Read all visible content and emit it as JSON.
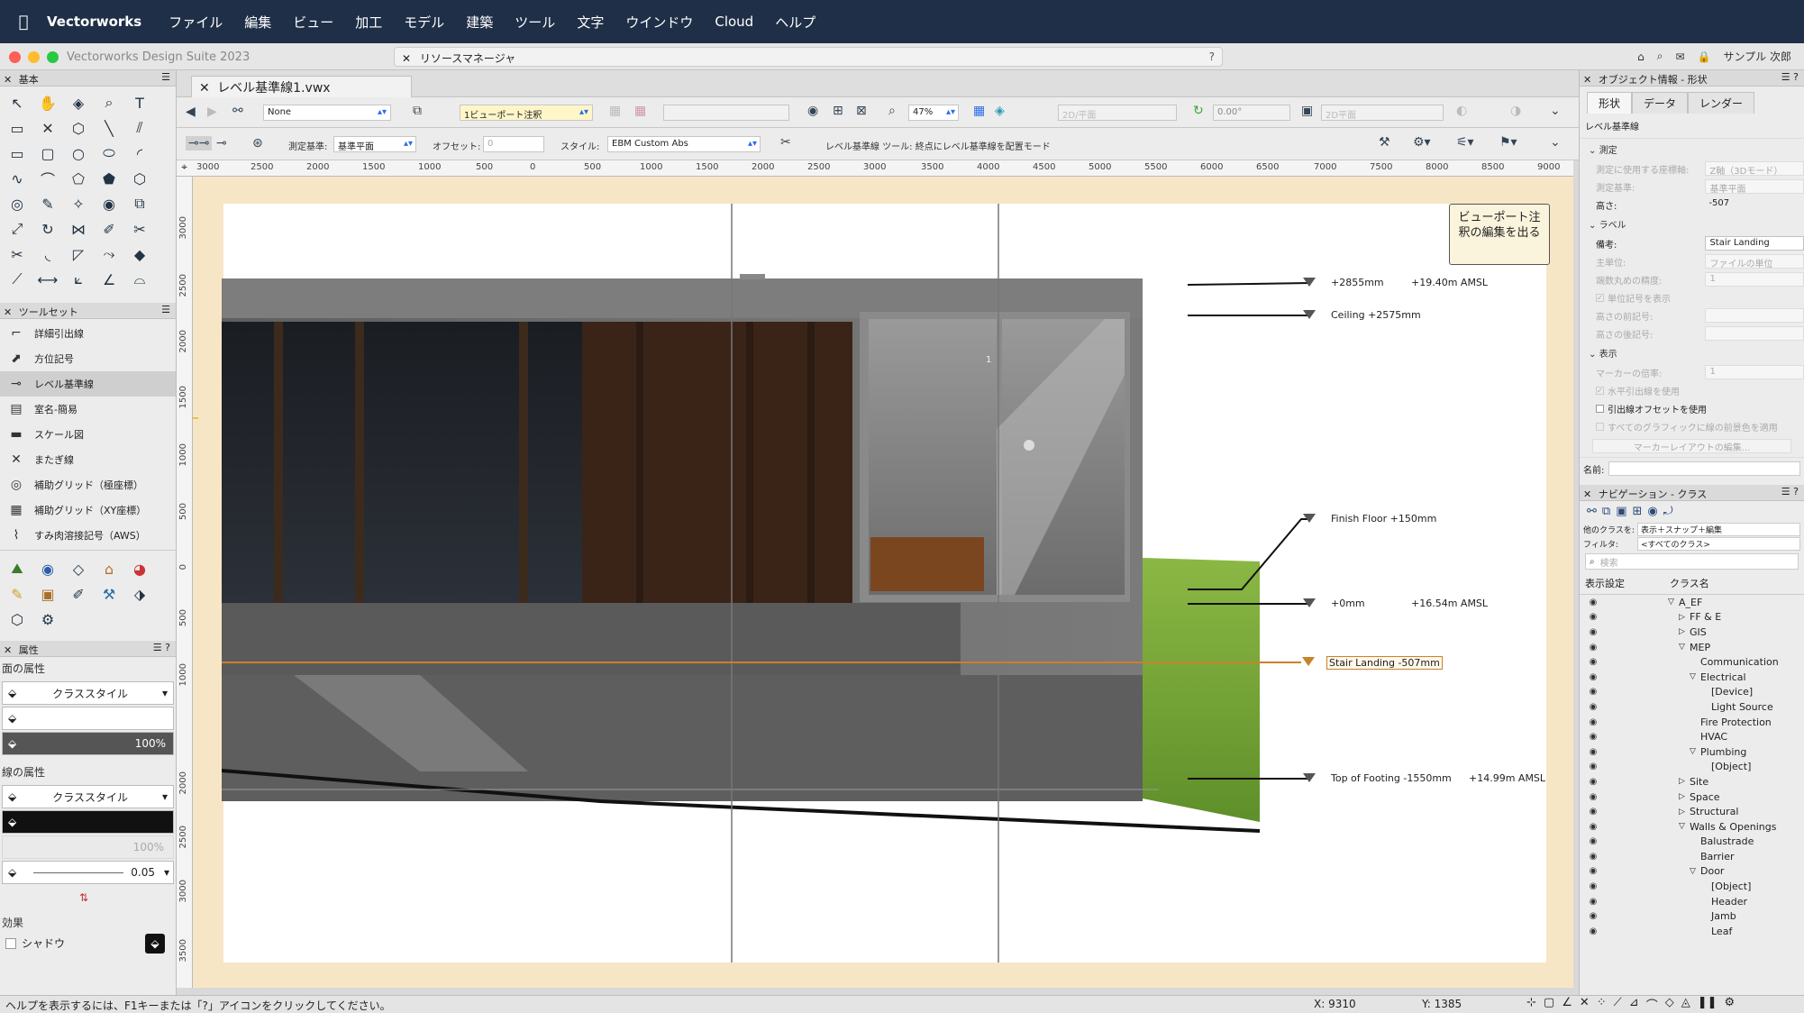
{
  "menubar": {
    "app_name": "Vectorworks",
    "items": [
      "ファイル",
      "編集",
      "ビュー",
      "加工",
      "モデル",
      "建築",
      "ツール",
      "文字",
      "ウインドウ",
      "Cloud",
      "ヘルプ"
    ]
  },
  "window": {
    "app_title": "Vectorworks Design Suite 2023",
    "resource_manager": "リソースマネージャ",
    "resource_manager_help": "?",
    "user": "サンプル 次郎"
  },
  "left_panel": {
    "basic_title": "基本",
    "toolset_title": "ツールセット",
    "toolset_items": [
      {
        "label": "詳細引出線",
        "icon": "detail-callout-icon"
      },
      {
        "label": "方位記号",
        "icon": "north-arrow-icon"
      },
      {
        "label": "レベル基準線",
        "icon": "level-datum-icon",
        "selected": true
      },
      {
        "label": "室名-簡易",
        "icon": "room-name-icon"
      },
      {
        "label": "スケール図",
        "icon": "scale-bar-icon"
      },
      {
        "label": "またぎ線",
        "icon": "cross-line-icon"
      },
      {
        "label": "補助グリッド（極座標）",
        "icon": "polar-grid-icon"
      },
      {
        "label": "補助グリッド（XY座標）",
        "icon": "xy-grid-icon"
      },
      {
        "label": "すみ肉溶接記号（AWS）",
        "icon": "weld-symbol-icon"
      }
    ],
    "attributes_title": "属性",
    "fill_label": "面の属性",
    "fill_style": "クラススタイル",
    "opacity": "100%",
    "pen_label": "線の属性",
    "pen_style": "クラススタイル",
    "pen_opacity": "100%",
    "line_weight": "0.05",
    "effects_label": "効果",
    "shadow_label": "シャドウ"
  },
  "document": {
    "tab_title": "レベル基準線1.vwx",
    "view": {
      "class_value": "None",
      "layer_value": "1ビューポート注釈",
      "zoom": "47%",
      "view_type": "2D/平面",
      "rotation": "0.00°",
      "plane": "2D平面"
    },
    "mode": {
      "measure_label": "測定基準:",
      "measure_value": "基準平面",
      "offset_label": "オフセット:",
      "offset_value": "0",
      "style_label": "スタイル:",
      "style_value": "EBM Custom Abs",
      "hint": "レベル基準線 ツール: 終点にレベル基準線を配置モード"
    }
  },
  "ruler": {
    "top": [
      "3000",
      "2500",
      "2000",
      "1500",
      "1000",
      "500",
      "0",
      "500",
      "1000",
      "1500",
      "2000",
      "2500",
      "3000",
      "3500",
      "4000",
      "4500",
      "5000",
      "5500",
      "6000",
      "6500",
      "7000",
      "7500",
      "8000",
      "8500",
      "9000"
    ],
    "left": [
      "3000",
      "2500",
      "2000",
      "1500",
      "1000",
      "500",
      "0",
      "500",
      "1000",
      "2000",
      "2500",
      "3000",
      "3500"
    ]
  },
  "drawing": {
    "exit_button": "ビューポート注釈の編集を出る",
    "levels": [
      {
        "label": "+2855mm",
        "amsl": "+19.40m AMSL"
      },
      {
        "label": "Ceiling +2575mm",
        "amsl": ""
      },
      {
        "label": "Finish Floor +150mm",
        "amsl": ""
      },
      {
        "label": "+0mm",
        "amsl": "+16.54m AMSL"
      },
      {
        "label": "Stair Landing -507mm",
        "amsl": ""
      },
      {
        "label": "Top of Footing -1550mm",
        "amsl": "+14.99m AMSL"
      }
    ],
    "shower_tag": "1"
  },
  "object_info": {
    "title": "オブジェクト情報 - 形状",
    "tabs": [
      "形状",
      "データ",
      "レンダー"
    ],
    "object_type": "レベル基準線",
    "section_measure": "測定",
    "rows_measure": [
      {
        "label": "測定に使用する座標軸:",
        "value": "Z軸（3Dモード）"
      },
      {
        "label": "測定基準:",
        "value": "基準平面"
      },
      {
        "label": "高さ:",
        "value": "-507",
        "enabled": true
      }
    ],
    "section_label": "ラベル",
    "rows_label": [
      {
        "label": "備考:",
        "value": "Stair Landing",
        "enabled": true
      },
      {
        "label": "主単位:",
        "value": "ファイルの単位"
      },
      {
        "label": "端数丸めの精度:",
        "value": "1"
      }
    ],
    "check_unit": "単位記号を表示",
    "rows_label2": [
      {
        "label": "高さの前記号:",
        "value": ""
      },
      {
        "label": "高さの後記号:",
        "value": ""
      }
    ],
    "section_display": "表示",
    "rows_display": [
      {
        "label": "マーカーの倍率:",
        "value": "1"
      }
    ],
    "check_horizontal": "水平引出線を使用",
    "check_offset": "引出線オフセットを使用",
    "check_all_graphic": "すべてのグラフィックに線の前景色を適用",
    "marker_button": "マーカーレイアウトの編集...",
    "name_label": "名前:",
    "name_value": ""
  },
  "navigation": {
    "title": "ナビゲーション - クラス",
    "other_classes_label": "他のクラスを:",
    "other_classes_value": "表示＋スナップ＋編集",
    "filter_label": "フィルタ:",
    "filter_value": "<すべてのクラス>",
    "search_placeholder": "検索",
    "col_visibility": "表示設定",
    "col_class": "クラス名",
    "classes": [
      {
        "name": "A_EF",
        "indent": 0,
        "arrow": "▽"
      },
      {
        "name": "FF & E",
        "indent": 1,
        "arrow": "▷"
      },
      {
        "name": "GIS",
        "indent": 1,
        "arrow": "▷"
      },
      {
        "name": "MEP",
        "indent": 1,
        "arrow": "▽"
      },
      {
        "name": "Communication",
        "indent": 2,
        "arrow": ""
      },
      {
        "name": "Electrical",
        "indent": 2,
        "arrow": "▽"
      },
      {
        "name": "[Device]",
        "indent": 3,
        "arrow": ""
      },
      {
        "name": "Light Source",
        "indent": 3,
        "arrow": ""
      },
      {
        "name": "Fire Protection",
        "indent": 2,
        "arrow": ""
      },
      {
        "name": "HVAC",
        "indent": 2,
        "arrow": ""
      },
      {
        "name": "Plumbing",
        "indent": 2,
        "arrow": "▽"
      },
      {
        "name": "[Object]",
        "indent": 3,
        "arrow": ""
      },
      {
        "name": "Site",
        "indent": 1,
        "arrow": "▷"
      },
      {
        "name": "Space",
        "indent": 1,
        "arrow": "▷"
      },
      {
        "name": "Structural",
        "indent": 1,
        "arrow": "▷"
      },
      {
        "name": "Walls & Openings",
        "indent": 1,
        "arrow": "▽"
      },
      {
        "name": "Balustrade",
        "indent": 2,
        "arrow": ""
      },
      {
        "name": "Barrier",
        "indent": 2,
        "arrow": ""
      },
      {
        "name": "Door",
        "indent": 2,
        "arrow": "▽"
      },
      {
        "name": "[Object]",
        "indent": 3,
        "arrow": ""
      },
      {
        "name": "Header",
        "indent": 3,
        "arrow": ""
      },
      {
        "name": "Jamb",
        "indent": 3,
        "arrow": ""
      },
      {
        "name": "Leaf",
        "indent": 3,
        "arrow": ""
      }
    ]
  },
  "status": {
    "help": "ヘルプを表示するには、F1キーまたは「?」アイコンをクリックしてください。",
    "x": "X: 9310",
    "y": "Y: 1385"
  },
  "colors": {
    "menubar": "#1f2f48",
    "canvas_bg": "#f7e6c6",
    "stair_landing": "#c8822a",
    "grass": "#7fa83a",
    "concrete": "#6e6e6e"
  }
}
